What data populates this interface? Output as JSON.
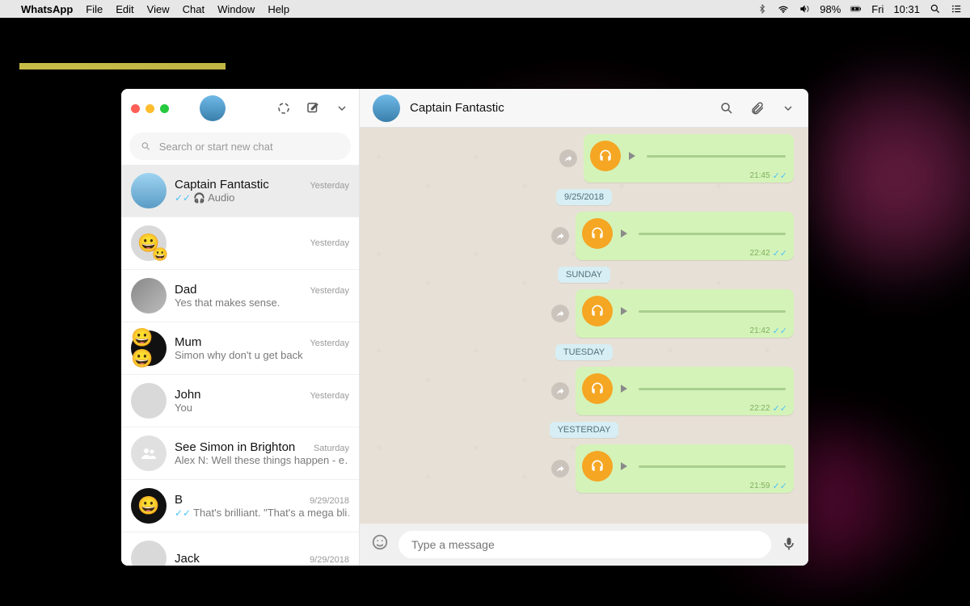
{
  "menubar": {
    "app": "WhatsApp",
    "items": [
      "File",
      "Edit",
      "View",
      "Chat",
      "Window",
      "Help"
    ],
    "battery": "98%",
    "day": "Fri",
    "time": "10:31"
  },
  "sidebar": {
    "search_placeholder": "Search or start new chat",
    "chats": [
      {
        "name": "Captain Fantastic",
        "preview": "Audio",
        "time": "Yesterday",
        "read": true,
        "audio": true,
        "avatar": "sky"
      },
      {
        "name": "",
        "preview": "",
        "time": "Yesterday",
        "avatar": "emoji"
      },
      {
        "name": "Dad",
        "preview": "Yes that makes sense.",
        "time": "Yesterday",
        "avatar": "photo"
      },
      {
        "name": "Mum",
        "preview": "Simon why don't u get back",
        "time": "Yesterday",
        "avatar": "emoji2"
      },
      {
        "name": "John",
        "preview": "You",
        "time": "Yesterday",
        "avatar": "blank"
      },
      {
        "name": "See Simon in Brighton",
        "preview": "Alex N: Well these things happen - e…",
        "time": "Saturday",
        "avatar": "group"
      },
      {
        "name": "B",
        "preview": "That's brilliant. \"That's a mega bli…",
        "time": "9/29/2018",
        "read": true,
        "avatar": "black"
      },
      {
        "name": "Jack",
        "preview": "",
        "time": "9/29/2018",
        "avatar": "blank"
      }
    ]
  },
  "conversation": {
    "title": "Captain Fantastic",
    "compose_placeholder": "Type a message",
    "items": [
      {
        "kind": "msg",
        "time": "21:45"
      },
      {
        "kind": "date",
        "label": "9/25/2018"
      },
      {
        "kind": "msg",
        "time": "22:42"
      },
      {
        "kind": "date",
        "label": "SUNDAY"
      },
      {
        "kind": "msg",
        "time": "21:42"
      },
      {
        "kind": "date",
        "label": "TUESDAY"
      },
      {
        "kind": "msg",
        "time": "22:22"
      },
      {
        "kind": "date",
        "label": "YESTERDAY"
      },
      {
        "kind": "msg",
        "time": "21:59"
      }
    ]
  }
}
